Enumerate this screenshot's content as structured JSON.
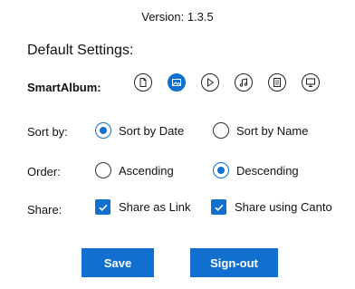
{
  "version_text": "Version: 1.3.5",
  "section_title": "Default Settings:",
  "smart_album": {
    "label": "SmartAlbum:",
    "icons": [
      {
        "name": "document-icon",
        "active": false
      },
      {
        "name": "image-icon",
        "active": true
      },
      {
        "name": "video-play-icon",
        "active": false
      },
      {
        "name": "music-note-icon",
        "active": false
      },
      {
        "name": "text-document-icon",
        "active": false
      },
      {
        "name": "presentation-icon",
        "active": false
      }
    ]
  },
  "sort_by": {
    "label": "Sort by:",
    "options": [
      "Sort by Date",
      "Sort by Name"
    ],
    "selected": "Sort by Date"
  },
  "order": {
    "label": "Order:",
    "options": [
      "Ascending",
      "Descending"
    ],
    "selected": "Descending"
  },
  "share": {
    "label": "Share:",
    "options": [
      "Share as Link",
      "Share using Canto"
    ],
    "checked": [
      true,
      true
    ]
  },
  "buttons": {
    "save": "Save",
    "signout": "Sign-out"
  },
  "colors": {
    "accent": "#1170cf"
  }
}
